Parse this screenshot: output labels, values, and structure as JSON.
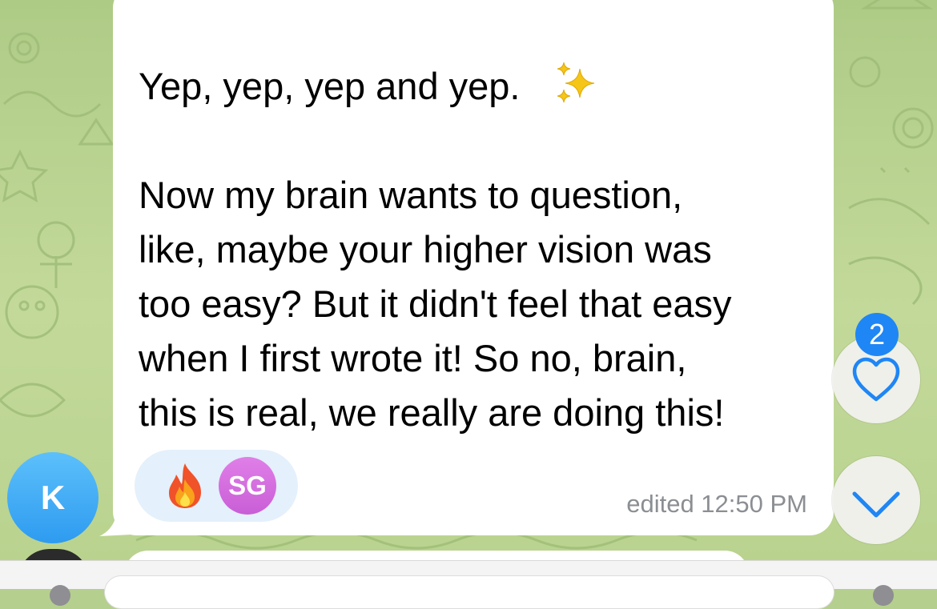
{
  "message": {
    "lines": [
      "Yep, yep, yep and yep.",
      "",
      "Now my brain wants to question,",
      "like, maybe your higher vision was",
      "too easy? But it didn't feel that easy",
      "when I first wrote it! So no, brain,",
      "this is real, we really are doing this!"
    ],
    "emoji": "sparkles",
    "status": "edited 12:50 PM"
  },
  "reactions": {
    "emoji": "fire",
    "reactor_initials": "SG"
  },
  "sender": {
    "initials": "K"
  },
  "side_buttons": {
    "reactions_badge": "2"
  },
  "colors": {
    "chat_background": "#b5cf8e",
    "bubble": "#ffffff",
    "reaction_pill": "#e4f0fb",
    "accent_blue": "#1f86f5",
    "avatar_k": "#3aa8f5",
    "avatar_sg": "#d56ee0",
    "timestamp": "#8b8e92"
  }
}
